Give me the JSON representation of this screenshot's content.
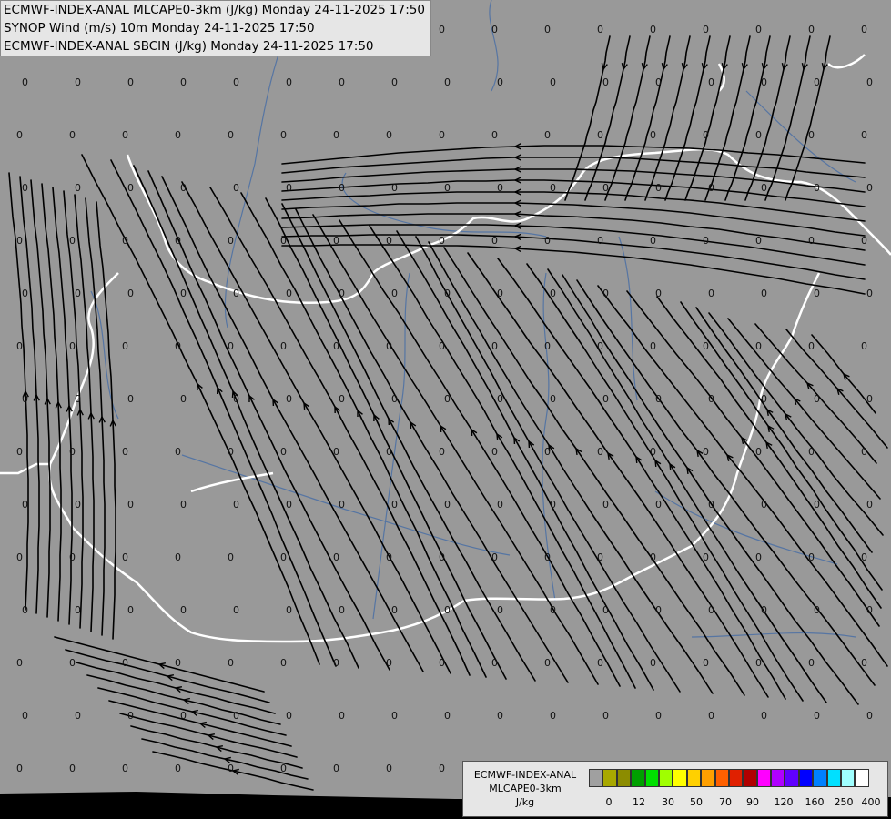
{
  "header": {
    "line1": "ECMWF-INDEX-ANAL MLCAPE0-3km (J/kg) Monday 24-11-2025 17:50",
    "line2": "SYNOP Wind (m/s) 10m Monday 24-11-2025 17:50",
    "line3": "ECMWF-INDEX-ANAL SBCIN (J/kg) Monday 24-11-2025 17:50"
  },
  "legend": {
    "title1": "ECMWF-INDEX-ANAL",
    "title2": "MLCAPE0-3km",
    "unit": "J/kg",
    "tick_labels": [
      "0",
      "12",
      "30",
      "50",
      "70",
      "90",
      "120",
      "160",
      "250",
      "400"
    ],
    "colors": [
      "#a0a0a0",
      "#a8a800",
      "#8c8c00",
      "#00a000",
      "#00e000",
      "#a0ff00",
      "#ffff00",
      "#ffd000",
      "#ffa000",
      "#ff6000",
      "#e02000",
      "#b00000",
      "#ff00ff",
      "#b000ff",
      "#6000ff",
      "#0000ff",
      "#0080ff",
      "#00e0ff",
      "#a0ffff",
      "#ffffff"
    ]
  },
  "map": {
    "background_color": "#999999",
    "bottom_band_color": "#000000",
    "border_color": "#ffffff",
    "river_color": "#4a6fa5",
    "streamline_color": "#000000",
    "grid_value": "0"
  }
}
